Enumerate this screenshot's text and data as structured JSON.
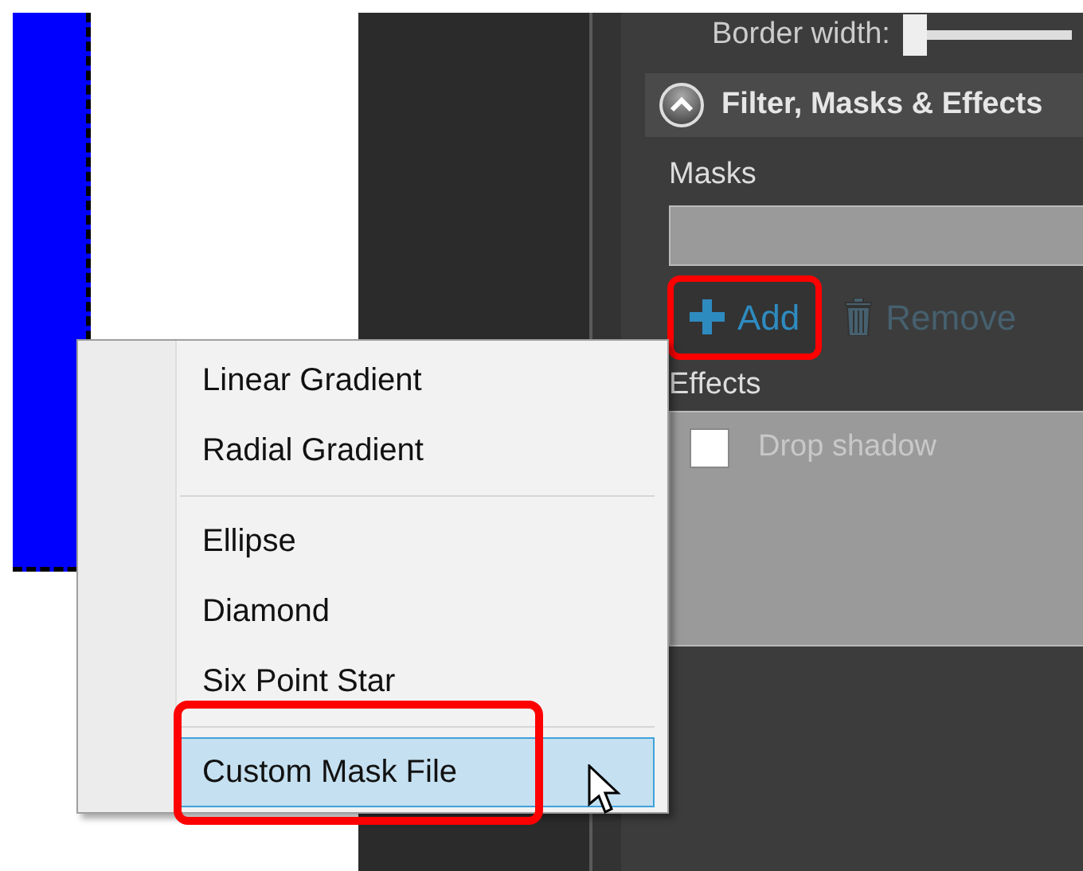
{
  "canvas": {
    "shape": {
      "kind": "rectangle",
      "color": "#0000ff",
      "selected": true
    }
  },
  "panel": {
    "border_width": {
      "label": "Border width:",
      "level": 0
    },
    "section": {
      "title": "Filter, Masks & Effects",
      "expanded": true
    },
    "masks": {
      "label": "Masks"
    },
    "mask_buttons": [
      {
        "label": "Add",
        "disabled": false,
        "highlighted": true
      },
      {
        "label": "Remove",
        "disabled": true,
        "highlighted": false
      }
    ],
    "effects": {
      "label": "Effects",
      "items": [
        {
          "label": "Drop shadow",
          "checked": false,
          "disabled": true
        }
      ]
    }
  },
  "context_menu": {
    "items": [
      {
        "kind": "item",
        "label": "Linear Gradient",
        "selected": false,
        "highlighted": false
      },
      {
        "kind": "item",
        "label": "Radial Gradient",
        "selected": false,
        "highlighted": false
      },
      {
        "kind": "separator"
      },
      {
        "kind": "item",
        "label": "Ellipse",
        "selected": false,
        "highlighted": false
      },
      {
        "kind": "item",
        "label": "Diamond",
        "selected": false,
        "highlighted": false
      },
      {
        "kind": "item",
        "label": "Six Point Star",
        "selected": false,
        "highlighted": false
      },
      {
        "kind": "separator"
      },
      {
        "kind": "item",
        "label": "Custom Mask File",
        "selected": true,
        "highlighted": true
      }
    ]
  }
}
